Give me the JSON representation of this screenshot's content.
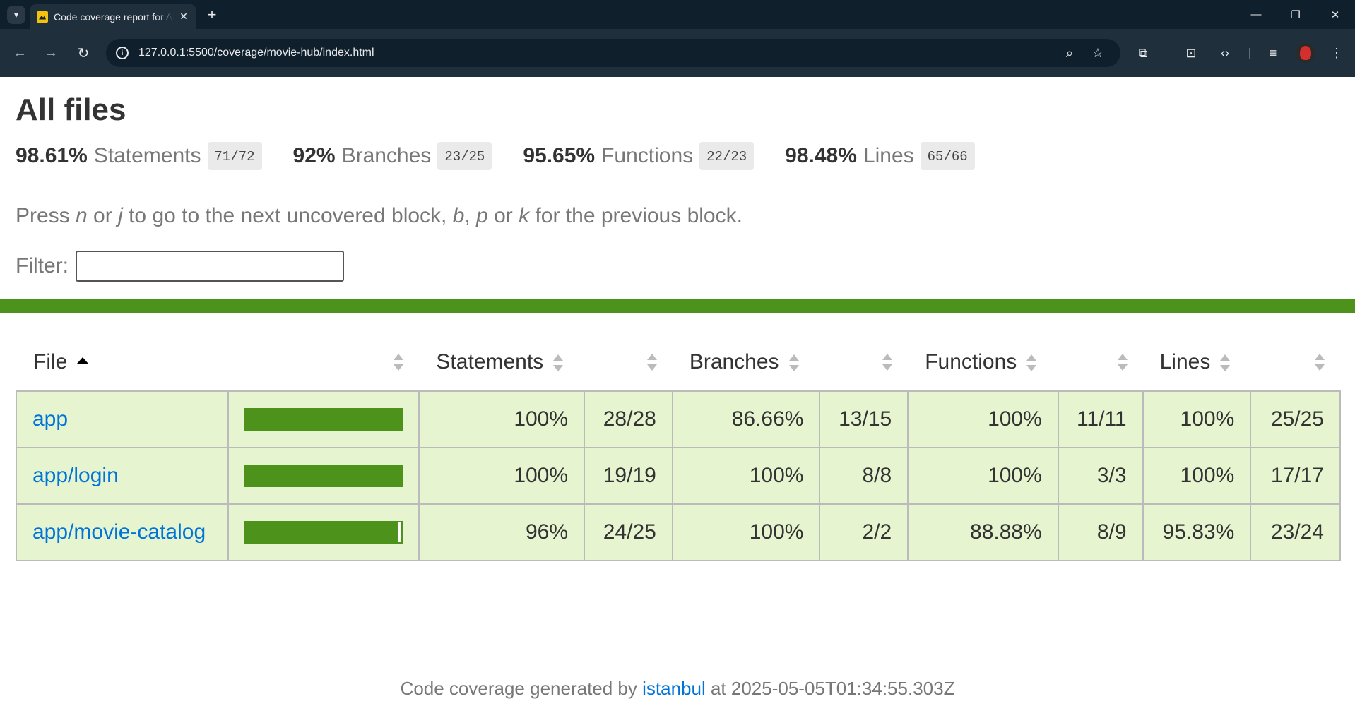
{
  "browser": {
    "tab_title": "Code coverage report for All files",
    "url": "127.0.0.1:5500/coverage/movie-hub/index.html"
  },
  "page": {
    "title": "All files",
    "summary": [
      {
        "pct": "98.61%",
        "label": "Statements",
        "frac": "71/72"
      },
      {
        "pct": "92%",
        "label": "Branches",
        "frac": "23/25"
      },
      {
        "pct": "95.65%",
        "label": "Functions",
        "frac": "22/23"
      },
      {
        "pct": "98.48%",
        "label": "Lines",
        "frac": "65/66"
      }
    ],
    "hint": {
      "p1": "Press ",
      "k1": "n",
      "p2": " or ",
      "k2": "j",
      "p3": " to go to the next uncovered block, ",
      "k3": "b",
      "p4": ", ",
      "k4": "p",
      "p5": " or ",
      "k5": "k",
      "p6": " for the previous block."
    },
    "filter_label": "Filter:",
    "filter_value": ""
  },
  "table": {
    "headers": {
      "file": "File",
      "statements": "Statements",
      "branches": "Branches",
      "functions": "Functions",
      "lines": "Lines"
    },
    "rows": [
      {
        "file": "app",
        "coverage": 1.0,
        "stmt_pct": "100%",
        "stmt_frac": "28/28",
        "br_pct": "86.66%",
        "br_frac": "13/15",
        "fn_pct": "100%",
        "fn_frac": "11/11",
        "ln_pct": "100%",
        "ln_frac": "25/25"
      },
      {
        "file": "app/login",
        "coverage": 1.0,
        "stmt_pct": "100%",
        "stmt_frac": "19/19",
        "br_pct": "100%",
        "br_frac": "8/8",
        "fn_pct": "100%",
        "fn_frac": "3/3",
        "ln_pct": "100%",
        "ln_frac": "17/17"
      },
      {
        "file": "app/movie-catalog",
        "coverage": 0.96,
        "stmt_pct": "96%",
        "stmt_frac": "24/25",
        "br_pct": "100%",
        "br_frac": "2/2",
        "fn_pct": "88.88%",
        "fn_frac": "8/9",
        "ln_pct": "95.83%",
        "ln_frac": "23/24"
      }
    ]
  },
  "footer": {
    "prefix": "Code coverage generated by ",
    "link": "istanbul",
    "suffix": " at 2025-05-05T01:34:55.303Z"
  },
  "colors": {
    "high_bar": "#4d921b",
    "high_row": "#e6f5d0",
    "link": "#0074d9"
  }
}
